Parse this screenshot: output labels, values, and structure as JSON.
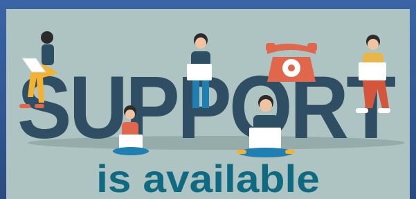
{
  "banner": {
    "headline": "SUPPORT",
    "tagline": "is  available"
  },
  "colors": {
    "frame": "#2d4f86",
    "panel": "#aec4c2",
    "headline": "#2f4e63",
    "tagline": "#0f6a81",
    "phone": "#e0674b"
  },
  "illustration": {
    "figures": [
      "support-agent-sitting-on-letter",
      "support-agent-with-headset",
      "support-agent-cross-legged",
      "support-agent-center-laptop",
      "support-agent-bearded"
    ],
    "objects": [
      "rotary-telephone"
    ]
  }
}
